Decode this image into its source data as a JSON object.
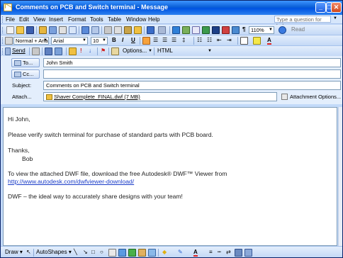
{
  "window": {
    "title": "Comments on PCB and Switch terminal - Message"
  },
  "menu": {
    "items": [
      "File",
      "Edit",
      "View",
      "Insert",
      "Format",
      "Tools",
      "Table",
      "Window",
      "Help"
    ],
    "ask_placeholder": "Type a question for help"
  },
  "standard_toolbar": {
    "zoom": "110%",
    "read_label": "Read"
  },
  "format_toolbar": {
    "style": "Normal + Arial,",
    "font": "Arial",
    "size": "10",
    "bold": "B",
    "italic": "I",
    "underline": "U"
  },
  "email_toolbar": {
    "send_label": "Send",
    "options_label": "Options...",
    "format": "HTML"
  },
  "header": {
    "to_label": "To...",
    "to_value": "John Smith",
    "cc_label": "Cc...",
    "cc_value": "",
    "subject_label": "Subject:",
    "subject_value": "Comments on PCB and Switch terminal",
    "attach_label": "Attach...",
    "attach_file": "Shaver Complete_FINAL.dwf (7 MB)",
    "attach_options": "Attachment Options..."
  },
  "body": {
    "greeting": "Hi John,",
    "line1": "Please verify switch terminal for purchase of standard parts with PCB board.",
    "thanks": "Thanks,",
    "signature": "Bob",
    "dwf_line": "To view the attached DWF file, download the free Autodesk® DWF™ Viewer from",
    "dwf_link": "http://www.autodesk.com/dwfviewer-download/",
    "tagline": "DWF – the ideal way to accurately share designs with your team!"
  },
  "drawing_toolbar": {
    "draw_label": "Draw ▾",
    "autoshapes_label": "AutoShapes ▾"
  }
}
